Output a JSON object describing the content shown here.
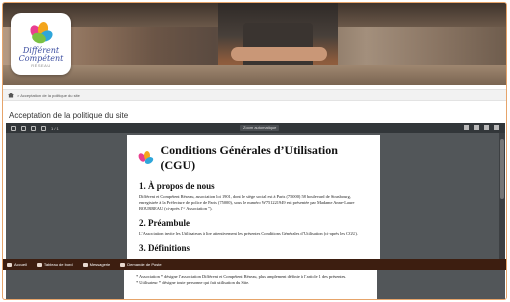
{
  "brand": {
    "line1": "Différent",
    "line2": "Compétent",
    "line3": "RÉSEAU"
  },
  "breadcrumb": {
    "text": "> Acceptation de la politique du site"
  },
  "page_title": "Acceptation de la politique du site",
  "viewer": {
    "page_indicator": "1 / 1",
    "zoom": "Zoom automatique"
  },
  "document": {
    "title": "Conditions Générales d’Utilisation (CGU)",
    "sections": [
      {
        "heading": "1. À propos de nous",
        "body": "Différent et Compétent Réseau, association loi 1901, dont le siège social est à Paris (75000) 58 boulevard de Strasbourg, enregistrée à la Préfecture de police de Paris (75000), sous le numéro W751221949 est présentée par Madame Anne-Laure BOURREAU (ci-après l’“ Association ”)."
      },
      {
        "heading": "2. Préambule",
        "body": "L’Association invite les Utilisateurs à lire attentivement les présentes Conditions Générales d’Utilisation (ci-après les CGU)."
      },
      {
        "heading": "3. Définitions",
        "body": ""
      }
    ],
    "continuation": [
      "* Association * désigne l’association Différent et Compétent Réseau, plus amplement définie à l’article 1 des présentes.",
      "* Utilisateur * désigne toute personne qui fait utilisation du Site."
    ]
  },
  "footer_menu": [
    {
      "label": "Accueil",
      "icon": "home-icon"
    },
    {
      "label": "Tableau de bord",
      "icon": "dashboard-icon"
    },
    {
      "label": "Messagerie",
      "icon": "mail-icon"
    },
    {
      "label": "Demande de Poste",
      "icon": "request-icon"
    }
  ]
}
